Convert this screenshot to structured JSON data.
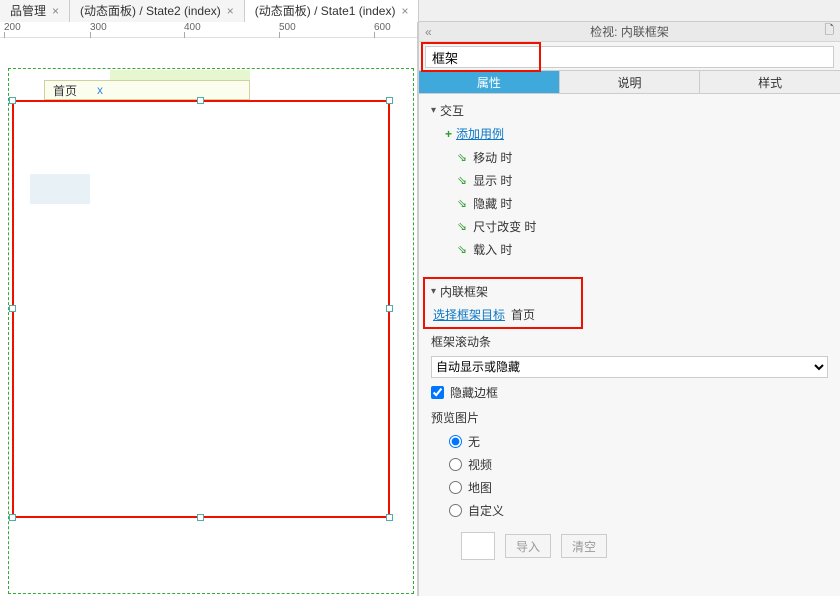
{
  "tabs": [
    {
      "label": "品管理"
    },
    {
      "label": "(动态面板) / State2 (index)"
    },
    {
      "label": "(动态面板) / State1 (index)"
    }
  ],
  "ruler_ticks": [
    "200",
    "300",
    "400",
    "500",
    "600"
  ],
  "canvas": {
    "home_tab_label": "首页",
    "home_tab_close": "x"
  },
  "panel_header": "检视: 内联框架",
  "widget_name_value": "框架",
  "panel_tabs": {
    "props": "属性",
    "notes": "说明",
    "style": "样式"
  },
  "interactions": {
    "title": "交互",
    "add_case": "添加用例",
    "events": [
      "移动 时",
      "显示 时",
      "隐藏 时",
      "尺寸改变 时",
      "载入 时"
    ]
  },
  "iframe": {
    "title": "内联框架",
    "select_target_link": "选择框架目标",
    "target_value": "首页",
    "scroll_label": "框架滚动条",
    "scroll_value": "自动显示或隐藏",
    "hide_border_label": "隐藏边框",
    "preview_label": "预览图片",
    "radios": {
      "none": "无",
      "video": "视频",
      "map": "地图",
      "custom": "自定义"
    },
    "import_btn": "导入",
    "clear_btn": "清空"
  }
}
